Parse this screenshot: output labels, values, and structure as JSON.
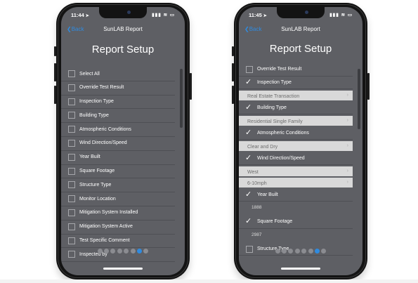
{
  "phones": [
    {
      "status": {
        "time": "11:44",
        "icons": "▮▮▮ ≋ ▭"
      },
      "nav": {
        "back": "Back",
        "title": "SunLAB Report"
      },
      "heading": "Report Setup",
      "rows": [
        {
          "label": "Select All",
          "checked": false
        },
        {
          "label": "Override Test Result",
          "checked": false
        },
        {
          "label": "Inspection Type",
          "checked": false
        },
        {
          "label": "Building Type",
          "checked": false
        },
        {
          "label": "Atmospheric Conditions",
          "checked": false
        },
        {
          "label": "Wind Direction/Speed",
          "checked": false
        },
        {
          "label": "Year Built",
          "checked": false
        },
        {
          "label": "Square Footage",
          "checked": false
        },
        {
          "label": "Structure Type",
          "checked": false
        },
        {
          "label": "Monitor Location",
          "checked": false
        },
        {
          "label": "Mitigation System Installed",
          "checked": false
        },
        {
          "label": "Mitigation System Active",
          "checked": false
        },
        {
          "label": "Test Specific Comment",
          "checked": false
        },
        {
          "label": "Inspected by",
          "checked": false
        }
      ],
      "page_dots": {
        "count": 8,
        "active": 7
      }
    },
    {
      "status": {
        "time": "11:45",
        "icons": "▮▮▮ ≋ ▭"
      },
      "nav": {
        "back": "Back",
        "title": "SunLAB Report"
      },
      "heading": "Report Setup",
      "rows": [
        {
          "label": "Override Test Result",
          "checked": false
        },
        {
          "label": "Inspection Type",
          "checked": true
        },
        {
          "label": "Real Estate Transaction",
          "kind": "select"
        },
        {
          "label": "Building Type",
          "checked": true
        },
        {
          "label": "Residential Single Family",
          "kind": "select"
        },
        {
          "label": "Atmospheric Conditions",
          "checked": true
        },
        {
          "label": "Clear and Dry",
          "kind": "select"
        },
        {
          "label": "Wind Direction/Speed",
          "checked": true
        },
        {
          "label": "West",
          "kind": "select"
        },
        {
          "label": "6-10mph",
          "kind": "select"
        },
        {
          "label": "Year Built",
          "checked": true
        },
        {
          "label": "1888",
          "kind": "value"
        },
        {
          "label": "Square Footage",
          "checked": true
        },
        {
          "label": "2987",
          "kind": "value"
        },
        {
          "label": "Structure Type",
          "checked": false
        }
      ],
      "page_dots": {
        "count": 8,
        "active": 7
      }
    }
  ],
  "icons": {
    "check": "✓",
    "chevron": "›",
    "back_chevron": "❮",
    "location_arrow": "➤"
  },
  "colors": {
    "accent": "#2f8be0",
    "screen_bg": "#5e5f64",
    "select_bg": "#d9d9d9"
  }
}
